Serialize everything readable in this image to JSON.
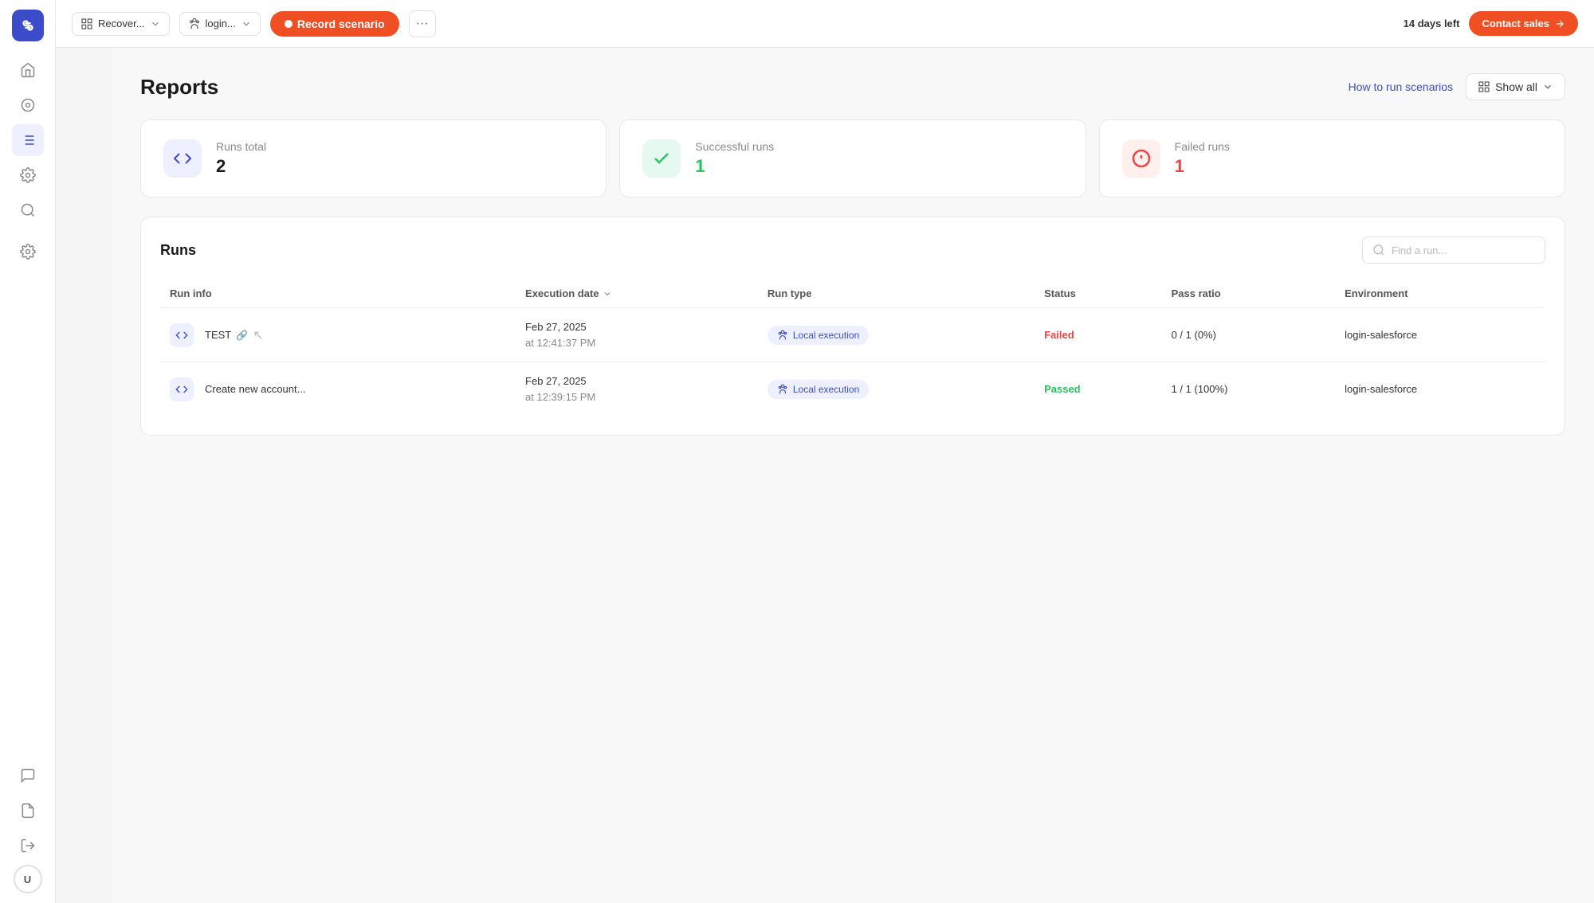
{
  "app": {
    "logo_label": "App Logo"
  },
  "toolbar": {
    "project_selector": "Recover...",
    "login_selector": "login...",
    "record_label": "Record scenario",
    "more_label": "...",
    "trial_days": "14",
    "trial_suffix": " days left",
    "contact_label": "Contact sales"
  },
  "reports": {
    "title": "Reports",
    "how_to_link": "How to run scenarios",
    "show_all_label": "Show all"
  },
  "stats": [
    {
      "label": "Runs total",
      "value": "2",
      "color": "blue"
    },
    {
      "label": "Successful runs",
      "value": "1",
      "color": "green"
    },
    {
      "label": "Failed runs",
      "value": "1",
      "color": "red"
    }
  ],
  "runs": {
    "title": "Runs",
    "search_placeholder": "Find a run...",
    "columns": [
      "Run info",
      "Execution date",
      "Run type",
      "Status",
      "Pass ratio",
      "Environment"
    ],
    "rows": [
      {
        "name": "TEST",
        "has_link": true,
        "date_line1": "Feb 27, 2025",
        "date_line2": "at 12:41:37 PM",
        "run_type": "Local execution",
        "status": "Failed",
        "pass_ratio": "0 / 1 (0%)",
        "environment": "login-salesforce"
      },
      {
        "name": "Create new account...",
        "has_link": false,
        "date_line1": "Feb 27, 2025",
        "date_line2": "at 12:39:15 PM",
        "run_type": "Local execution",
        "status": "Passed",
        "pass_ratio": "1 / 1 (100%)",
        "environment": "login-salesforce"
      }
    ]
  },
  "nav": {
    "items": [
      {
        "id": "home",
        "label": "Home",
        "icon": "⌂",
        "active": false
      },
      {
        "id": "recordings",
        "label": "Recordings",
        "icon": "◎",
        "active": false
      },
      {
        "id": "reports",
        "label": "Reports",
        "icon": "☰",
        "active": true
      },
      {
        "id": "settings",
        "label": "Settings",
        "icon": "⚙",
        "active": false
      },
      {
        "id": "search",
        "label": "Search",
        "icon": "⌕",
        "active": false
      }
    ],
    "bottom_items": [
      {
        "id": "chat",
        "label": "Chat",
        "icon": "💬"
      },
      {
        "id": "docs",
        "label": "Docs",
        "icon": "📄"
      },
      {
        "id": "logout",
        "label": "Logout",
        "icon": "↪"
      },
      {
        "id": "user",
        "label": "User",
        "icon": "U"
      }
    ]
  }
}
